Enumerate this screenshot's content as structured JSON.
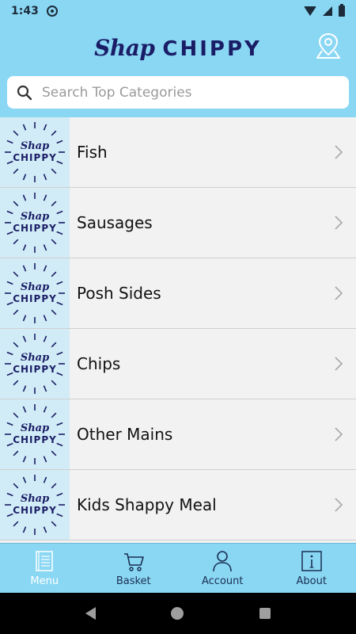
{
  "status_bar": {
    "time": "1:43"
  },
  "header": {
    "logo_script": "Shap",
    "logo_main": "CHIPPY"
  },
  "search": {
    "placeholder": "Search Top Categories",
    "value": ""
  },
  "categories": [
    {
      "label": "Fish",
      "thumb_script": "Shap",
      "thumb_main": "CHIPPY"
    },
    {
      "label": "Sausages",
      "thumb_script": "Shap",
      "thumb_main": "CHIPPY"
    },
    {
      "label": "Posh Sides",
      "thumb_script": "Shap",
      "thumb_main": "CHIPPY"
    },
    {
      "label": "Chips",
      "thumb_script": "Shap",
      "thumb_main": "CHIPPY"
    },
    {
      "label": "Other Mains",
      "thumb_script": "Shap",
      "thumb_main": "CHIPPY"
    },
    {
      "label": "Kids Shappy Meal",
      "thumb_script": "Shap",
      "thumb_main": "CHIPPY"
    }
  ],
  "bottom_nav": [
    {
      "label": "Menu",
      "icon": "menu-icon",
      "active": true
    },
    {
      "label": "Basket",
      "icon": "basket-icon",
      "active": false
    },
    {
      "label": "Account",
      "icon": "account-icon",
      "active": false
    },
    {
      "label": "About",
      "icon": "info-icon",
      "active": false
    }
  ],
  "colors": {
    "header_bg": "#8ad7f4",
    "brand_navy": "#1a1d66",
    "thumb_bg": "#d1ecf6",
    "list_bg": "#f2f2f2"
  }
}
